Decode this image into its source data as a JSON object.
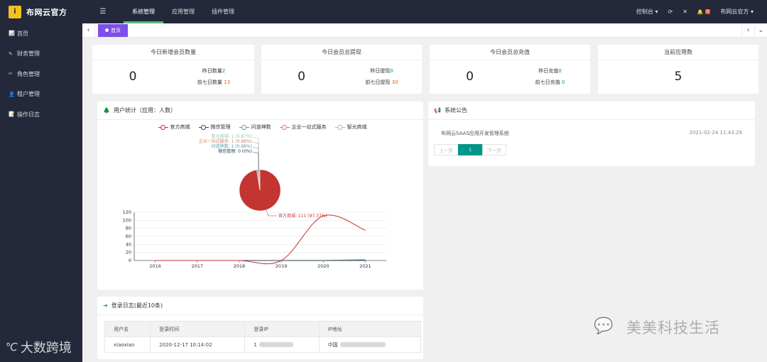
{
  "brand": {
    "logo_char": "i",
    "title": "布网云官方"
  },
  "topnav": {
    "menu_icon": "☰",
    "items": [
      "系统管理",
      "应用管理",
      "插件管理"
    ],
    "active_index": 0
  },
  "topright": {
    "console": "控制台 ▾",
    "refresh_icon": "⟳",
    "fullscreen_icon": "✕",
    "bell_icon": "🔔",
    "badge": "0",
    "user": "布网云官方 ▾"
  },
  "sidebar": {
    "items": [
      {
        "icon": "📊",
        "label": "首页"
      },
      {
        "icon": "✎",
        "label": "财务管理"
      },
      {
        "icon": "✂",
        "label": "角色管理"
      },
      {
        "icon": "👤",
        "label": "租户管理"
      },
      {
        "icon": "📝",
        "label": "操作日志"
      }
    ]
  },
  "tabs": {
    "left_arrow": "‹",
    "home_label": "首页",
    "right_arrow": "›",
    "down_arrow": "⌄"
  },
  "stats": [
    {
      "title": "今日新增会员数量",
      "value": "0",
      "line1_label": "昨日数量",
      "line1_value": "2",
      "line2_label": "前七日数量",
      "line2_value": "13"
    },
    {
      "title": "今日会员总提现",
      "value": "0",
      "line1_label": "昨日提现",
      "line1_value": "0",
      "line2_label": "前七日提现",
      "line2_value": "30"
    },
    {
      "title": "今日会员总充值",
      "value": "0",
      "line1_label": "昨日充值",
      "line1_value": "0",
      "line2_label": "前七日充值",
      "line2_value": "0"
    },
    {
      "title": "当前应用数",
      "value": "5"
    }
  ],
  "chart_panel": {
    "title": "用户统计（应用：人数）",
    "icon": "🌲"
  },
  "chart_data": [
    {
      "type": "pie",
      "legend": [
        "官方商城",
        "微信管理",
        "问道神数",
        "企业一站式服务",
        "智光商城"
      ],
      "slices": [
        {
          "name": "官方商城",
          "value": 111,
          "label": "官方商城: 111 (97.37%)",
          "color": "#c23531"
        },
        {
          "name": "微信管理",
          "value": 0,
          "label": "微信管理: 0 (0%)",
          "color": "#2f4554"
        },
        {
          "name": "问道神数",
          "value": 1,
          "label": "问道神数: 1 (0.88%)",
          "color": "#61a0a8"
        },
        {
          "name": "企业一站式服务",
          "value": 1,
          "label": "企业一站式服务: 1 (0.88%)",
          "color": "#d48265"
        },
        {
          "name": "智光商城",
          "value": 1,
          "label": "智光商城: 1 (0.87%)",
          "color": "#91c7ae"
        }
      ]
    },
    {
      "type": "line",
      "x": [
        "2016",
        "2017",
        "2018",
        "2019",
        "2020",
        "2021"
      ],
      "ylim": [
        0,
        120
      ],
      "yticks": [
        0,
        20,
        40,
        60,
        80,
        100,
        120
      ],
      "series": [
        {
          "name": "官方商城",
          "color": "#c23531",
          "values": [
            0,
            0,
            0,
            0,
            111,
            75
          ]
        },
        {
          "name": "微信管理",
          "color": "#2f4554",
          "values": [
            0,
            0,
            0,
            0,
            0,
            0
          ]
        },
        {
          "name": "问道神数",
          "color": "#61a0a8",
          "values": [
            0,
            0,
            0,
            0,
            0,
            1
          ]
        },
        {
          "name": "企业一站式服务",
          "color": "#d48265",
          "values": [
            0,
            0,
            0,
            0,
            0,
            1
          ]
        },
        {
          "name": "智光商城",
          "color": "#91c7ae",
          "values": [
            0,
            0,
            0,
            0,
            0,
            3
          ]
        }
      ]
    }
  ],
  "notice": {
    "title": "系统公告",
    "icon": "📢",
    "item_title": "布网云SAAS应用开发管理系统",
    "item_time": "2021-02-24 11:43:29",
    "pager": {
      "prev": "上一页",
      "current": "1",
      "next": "下一页"
    }
  },
  "login_log": {
    "title": "登录日志(最近10条)",
    "icon": "➜",
    "columns": [
      "用户名",
      "登录时间",
      "登录IP",
      "IP地址"
    ],
    "rows": [
      {
        "username": "xiaoxiao",
        "time": "2020-12-17 10:14:02",
        "ip": "1",
        "address": "中国"
      }
    ]
  },
  "watermarks": {
    "left_logo": "℃",
    "left_text": "大数跨境",
    "right_icon": "💬",
    "right_text": "美美科技生活"
  }
}
